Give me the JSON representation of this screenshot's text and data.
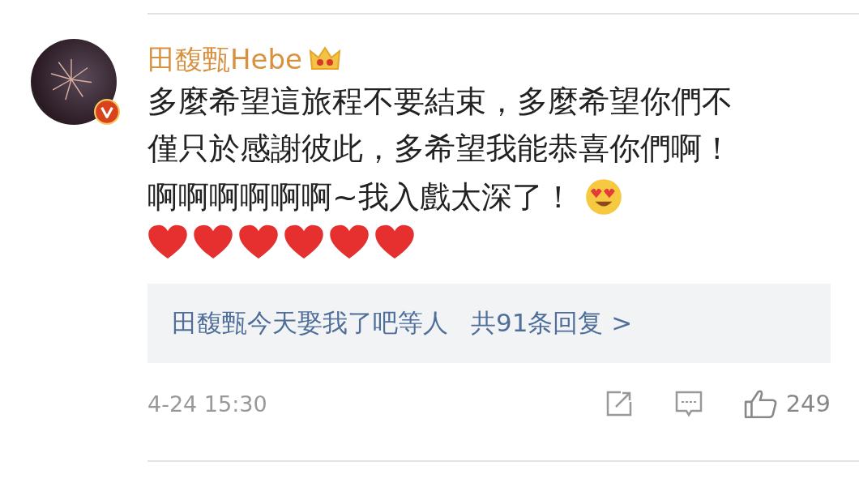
{
  "comment": {
    "author": "田馥甄Hebe",
    "text": "多麼希望這旅程不要結束，多麼希望你們不僅只於感謝彼此，多希望我能恭喜你們啊！",
    "text_2": "啊啊啊啊啊啊~我入戲太深了！",
    "replies": {
      "names": "田馥甄今天娶我了吧等人",
      "link": "共91条回复 >"
    },
    "time": "4-24 15:30",
    "likes": "249"
  }
}
